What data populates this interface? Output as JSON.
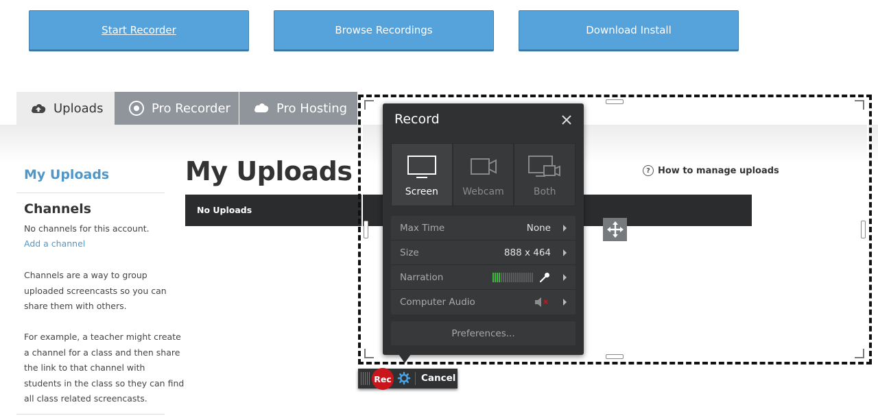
{
  "top_buttons": {
    "start": "Start Recorder",
    "browse": "Browse Recordings",
    "download": "Download Install"
  },
  "tabs": [
    {
      "label": "Uploads",
      "icon": "cloud-upload-icon",
      "active": true
    },
    {
      "label": "Pro Recorder",
      "icon": "record-circle-icon",
      "active": false
    },
    {
      "label": "Pro Hosting",
      "icon": "cloud-icon",
      "active": false
    }
  ],
  "sidebar": {
    "title": "My Uploads",
    "channels_heading": "Channels",
    "no_channels": "No channels for this account.",
    "add_channel": "Add a channel",
    "para1": [
      "Channels are a way to group",
      "uploaded screencasts so you can",
      "share them with others."
    ],
    "para2": [
      "For example, a teacher might create",
      "a channel for a class and then share",
      "the link to that channel with",
      "students in the class so they can find",
      "all class related screencasts."
    ]
  },
  "main": {
    "title": "My Uploads",
    "help_link": "How to manage uploads",
    "empty_text": "No Uploads"
  },
  "recorder": {
    "title": "Record",
    "modes": [
      {
        "label": "Screen",
        "icon": "monitor-icon",
        "selected": true
      },
      {
        "label": "Webcam",
        "icon": "webcam-icon",
        "selected": false
      },
      {
        "label": "Both",
        "icon": "screen-webcam-icon",
        "selected": false
      }
    ],
    "settings": {
      "max_time_label": "Max Time",
      "max_time_value": "None",
      "size_label": "Size",
      "size_value": "888 x 464",
      "narration_label": "Narration",
      "narration_level": 0.2,
      "computer_audio_label": "Computer Audio",
      "computer_audio_state": "muted"
    },
    "preferences": "Preferences...",
    "rec": "Rec",
    "cancel": "Cancel"
  },
  "colors": {
    "button_blue": "#56a3dc",
    "link_blue": "#4f97c9",
    "rec_red": "#c8161c",
    "meter_green": "#3dbb3d"
  }
}
